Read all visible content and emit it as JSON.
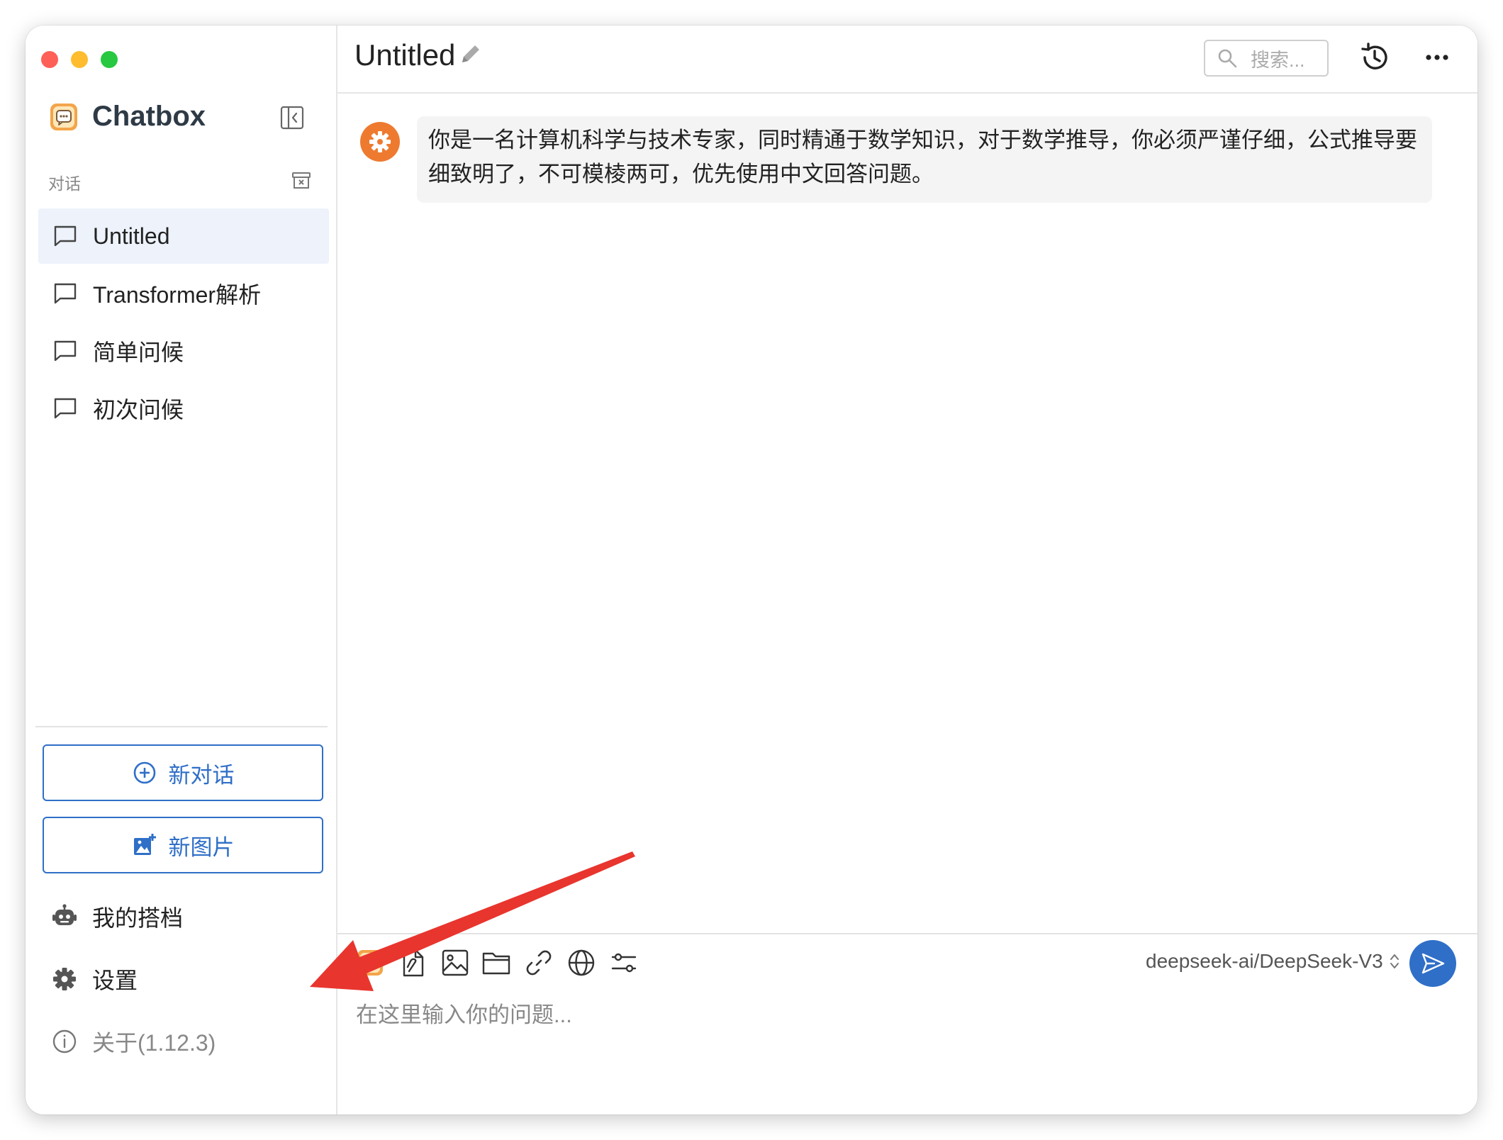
{
  "app": {
    "name": "Chatbox",
    "accent_color": "#2f6fc7",
    "annotation_arrow_color": "#e8352e"
  },
  "sidebar": {
    "section_label": "对话",
    "conversations": [
      {
        "label": "Untitled",
        "active": true
      },
      {
        "label": "Transformer解析",
        "active": false
      },
      {
        "label": "简单问候",
        "active": false
      },
      {
        "label": "初次问候",
        "active": false
      }
    ],
    "new_chat_label": "新对话",
    "new_image_label": "新图片",
    "menu": {
      "partners_label": "我的搭档",
      "settings_label": "设置",
      "about_label": "关于(1.12.3)"
    }
  },
  "header": {
    "title": "Untitled",
    "search_placeholder": "搜索..."
  },
  "messages": [
    {
      "role": "system",
      "avatar_icon": "gear-icon",
      "text": "你是一名计算机科学与技术专家，同时精通于数学知识，对于数学推导，你必须严谨仔细，公式推导要细致明了，不可模棱两可，优先使用中文回答问题。"
    }
  ],
  "composer": {
    "toolbar_icons": [
      "partner-avatar-icon",
      "file-icon",
      "image-icon",
      "folder-icon",
      "link-icon",
      "globe-icon",
      "sliders-icon"
    ],
    "model": "deepseek-ai/DeepSeek-V3",
    "placeholder": "在这里输入你的问题..."
  }
}
